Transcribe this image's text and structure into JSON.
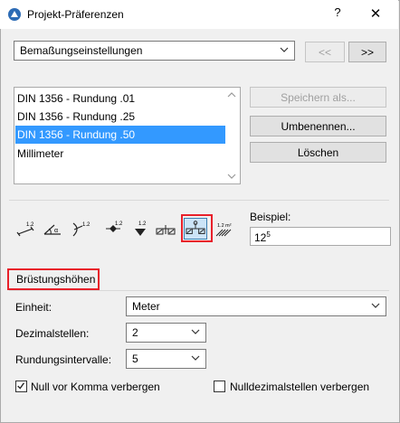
{
  "window": {
    "title": "Projekt-Präferenzen",
    "help_label": "?",
    "close_label": "✕"
  },
  "header": {
    "category_select": "Bemaßungseinstellungen",
    "prev_label": "<<",
    "next_label": ">>"
  },
  "scheme_list": {
    "items": [
      {
        "label": "DIN 1356 - Rundung .01",
        "selected": false
      },
      {
        "label": "DIN 1356 - Rundung .25",
        "selected": false
      },
      {
        "label": "DIN 1356 - Rundung .50",
        "selected": true
      },
      {
        "label": "Millimeter",
        "selected": false
      }
    ]
  },
  "actions": {
    "save_as": "Speichern als...",
    "rename": "Umbenennen...",
    "delete": "Löschen"
  },
  "toolbar": {
    "icons": [
      {
        "name": "linear-dimension-icon",
        "sup": "1.2"
      },
      {
        "name": "angle-dimension-icon",
        "sup": ""
      },
      {
        "name": "radial-dimension-icon",
        "sup": "1.2"
      },
      {
        "name": "level-dimension-icon",
        "sup": "1.2"
      },
      {
        "name": "elevation-dimension-icon",
        "sup": "1.2"
      },
      {
        "name": "door-window-dimension-icon",
        "sup": ""
      },
      {
        "name": "sill-height-dimension-icon",
        "sup": ""
      },
      {
        "name": "area-dimension-icon",
        "sup": "1.2 m²"
      }
    ]
  },
  "example": {
    "label": "Beispiel:",
    "value": "12",
    "value_sup": "5"
  },
  "section": {
    "title": "Brüstungshöhen"
  },
  "fields": {
    "unit_label": "Einheit:",
    "unit_value": "Meter",
    "decimals_label": "Dezimalstellen:",
    "decimals_value": "2",
    "rounding_label": "Rundungsintervalle:",
    "rounding_value": "5"
  },
  "options": {
    "hide_zero_label": "Null vor Komma verbergen",
    "hide_zero_checked": true,
    "hide_zero_decimals_label": "Nulldezimalstellen verbergen",
    "hide_zero_decimals_checked": false
  },
  "colors": {
    "selection": "#3399ff",
    "highlight": "#e8202a"
  }
}
